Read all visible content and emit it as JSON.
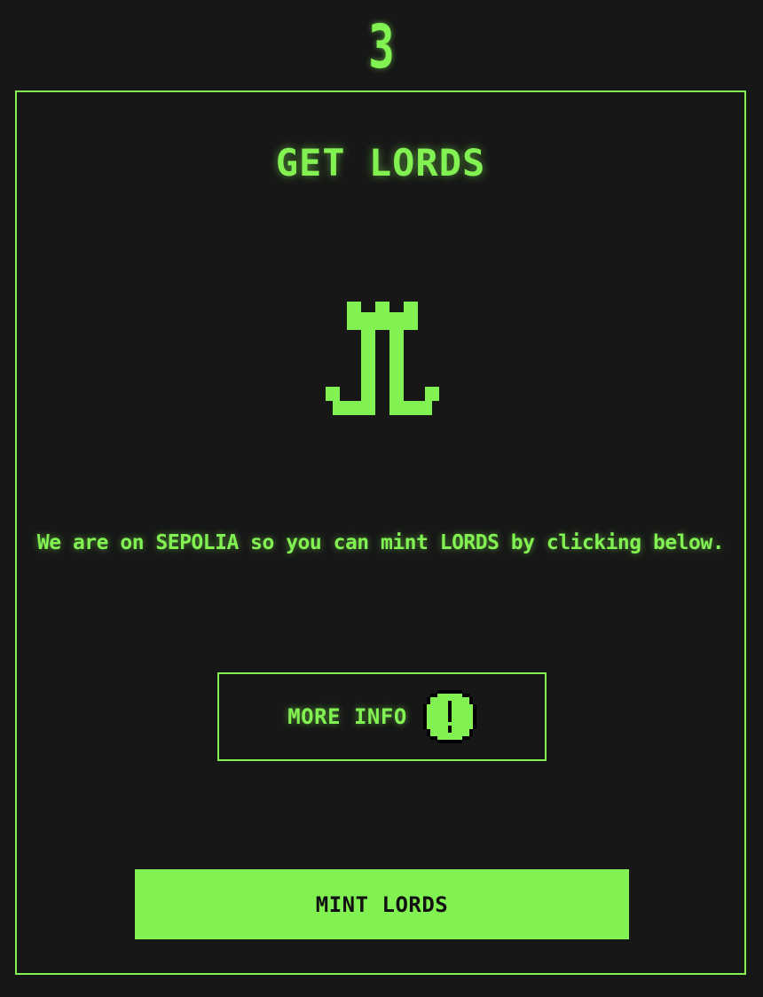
{
  "step": {
    "number": "3"
  },
  "panel": {
    "title": "GET LORDS",
    "icon": "lords-tower-icon",
    "message": "We are on SEPOLIA so you can mint LORDS by clicking below.",
    "more_info": {
      "label": "MORE INFO",
      "icon": "exclamation-icon"
    },
    "mint_button": {
      "label": "MINT LORDS"
    }
  },
  "colors": {
    "background": "#171717",
    "accent": "#82f152",
    "button_text": "#111111"
  }
}
